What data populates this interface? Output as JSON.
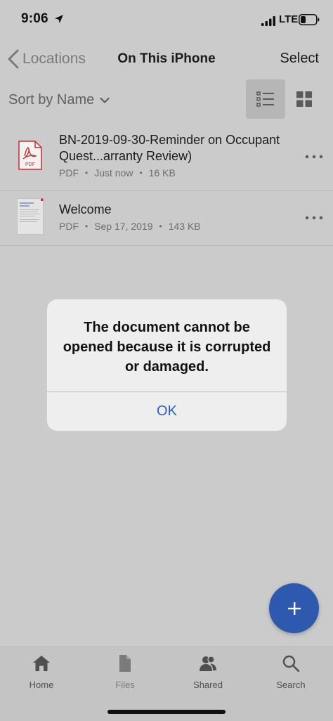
{
  "status_bar": {
    "time": "9:06",
    "network": "LTE",
    "icons": [
      "location-arrow-icon",
      "signal-icon",
      "battery-icon"
    ]
  },
  "nav_bar": {
    "back_label": "Locations",
    "title": "On This iPhone",
    "select_label": "Select",
    "icons": [
      "chevron-left-icon"
    ]
  },
  "sort_bar": {
    "sort_label": "Sort by Name",
    "list_view_selected": true,
    "icons": [
      "chevron-down-icon",
      "list-view-icon",
      "grid-view-icon"
    ]
  },
  "files": [
    {
      "name": "BN-2019-09-30-Reminder on Occupant Quest...arranty Review)",
      "type": "PDF",
      "date": "Just now",
      "size": "16 KB",
      "icon": "pdf-file-icon",
      "icon_label": "PDF"
    },
    {
      "name": "Welcome",
      "type": "PDF",
      "date": "Sep 17, 2019",
      "size": "143 KB",
      "icon": "document-thumbnail-icon"
    }
  ],
  "alert": {
    "message": "The document cannot be opened because it is corrupted or damaged.",
    "ok_label": "OK"
  },
  "fab": {
    "icon": "plus-icon"
  },
  "tabs": [
    {
      "label": "Home",
      "icon": "home-icon"
    },
    {
      "label": "Files",
      "icon": "files-icon"
    },
    {
      "label": "Shared",
      "icon": "shared-users-icon"
    },
    {
      "label": "Search",
      "icon": "search-icon"
    }
  ],
  "colors": {
    "background": "#cbcbcb",
    "accent": "#2d5aae",
    "alert_button": "#2b63b8",
    "pdf_red": "#c8312c"
  }
}
